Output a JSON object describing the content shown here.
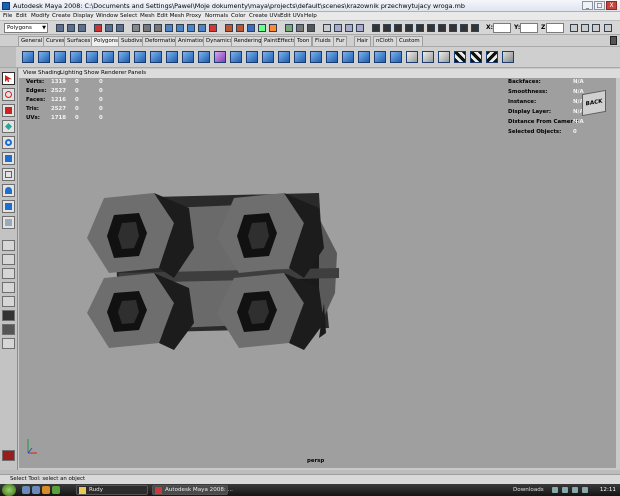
{
  "window": {
    "title": "Autodesk Maya 2008: C:\\Documents and Settings\\Pawel\\Moje dokumenty\\maya\\projects\\default\\scenes\\krazownik przechwytujacy wroga.mb",
    "minimize": "_",
    "maximize": "□",
    "close": "X"
  },
  "menubar": [
    "File",
    "Edit",
    "Modify",
    "Create",
    "Display",
    "Window",
    "Select",
    "Mesh",
    "Edit Mesh",
    "Proxy",
    "Normals",
    "Color",
    "Create UVs",
    "Edit UVs",
    "Help"
  ],
  "statusline": {
    "mode": "Polygons",
    "coord_labels": [
      "X:",
      "Y:",
      "Z:"
    ]
  },
  "shelf_tabs": [
    "General",
    "Curves",
    "Surfaces",
    "Polygons",
    "Subdivs",
    "Deformation",
    "Animation",
    "Dynamics",
    "Rendering",
    "PaintEffects",
    "Toon",
    "Fluids",
    "Fur",
    "Hair",
    "nCloth",
    "Custom"
  ],
  "active_shelf_tab": "Polygons",
  "panel_menu": [
    "View",
    "Shading",
    "Lighting",
    "Show",
    "Renderer",
    "Panels"
  ],
  "hud_left": [
    {
      "label": "Verts:",
      "values": [
        "1319",
        "0",
        "0"
      ]
    },
    {
      "label": "Edges:",
      "values": [
        "2527",
        "0",
        "0"
      ]
    },
    {
      "label": "Faces:",
      "values": [
        "1216",
        "0",
        "0"
      ]
    },
    {
      "label": "Tris:",
      "values": [
        "2527",
        "0",
        "0"
      ]
    },
    {
      "label": "UVs:",
      "values": [
        "1718",
        "0",
        "0"
      ]
    }
  ],
  "hud_right": [
    {
      "label": "Backfaces:",
      "value": "N/A"
    },
    {
      "label": "Smoothness:",
      "value": "N/A"
    },
    {
      "label": "Instance:",
      "value": "N/A"
    },
    {
      "label": "Display Layer:",
      "value": "N/A"
    },
    {
      "label": "Distance From Camera:",
      "value": "N/A"
    },
    {
      "label": "Selected Objects:",
      "value": "0"
    }
  ],
  "viewcube_label": "BACK",
  "camera_label": "persp",
  "help_line": "Select Tool: select an object",
  "taskbar": {
    "tasks": [
      "Rudy",
      "Autodesk Maya 2008: ..."
    ],
    "active_task": "Autodesk Maya 2008: ...",
    "tray_label": "Downloads",
    "clock": "12:11"
  },
  "colors": {
    "viewport_bg": "#9f9f9f",
    "model_dark": "#1f1f1f",
    "model_mid": "#4a4a4a",
    "model_light": "#6e6e6e"
  }
}
